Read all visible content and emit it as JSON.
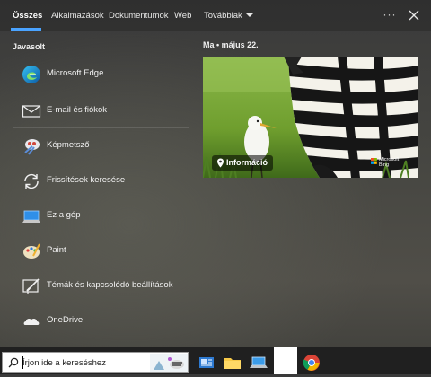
{
  "tabs": [
    {
      "label": "Összes",
      "active": true
    },
    {
      "label": "Alkalmazások"
    },
    {
      "label": "Dokumentumok"
    },
    {
      "label": "Web"
    },
    {
      "label": "Továbbiak"
    }
  ],
  "more_label": "···",
  "suggested": {
    "title": "Javasolt",
    "items": [
      {
        "label": "Microsoft Edge",
        "icon": "edge-icon"
      },
      {
        "label": "E-mail és fiókok",
        "icon": "mail-icon"
      },
      {
        "label": "Képmetsző",
        "icon": "snipping-tool-icon"
      },
      {
        "label": "Frissítések keresése",
        "icon": "sync-icon"
      },
      {
        "label": "Ez a gép",
        "icon": "this-pc-icon"
      },
      {
        "label": "Paint",
        "icon": "paint-icon"
      },
      {
        "label": "Témák és kapcsolódó beállítások",
        "icon": "themes-icon"
      },
      {
        "label": "OneDrive",
        "icon": "onedrive-icon"
      }
    ]
  },
  "today": {
    "date": "Ma  •  május 22.",
    "badge": "Információ",
    "bing_line1": "Microsoft",
    "bing_line2": "Bing"
  },
  "taskbar": {
    "search_placeholder": "Írjon ide a kereséshez",
    "pinned": [
      "news-icon",
      "file-explorer-icon",
      "laptop-icon",
      "chrome-icon"
    ]
  },
  "colors": {
    "accent": "#4aa3ff",
    "taskbar": "#202020"
  }
}
